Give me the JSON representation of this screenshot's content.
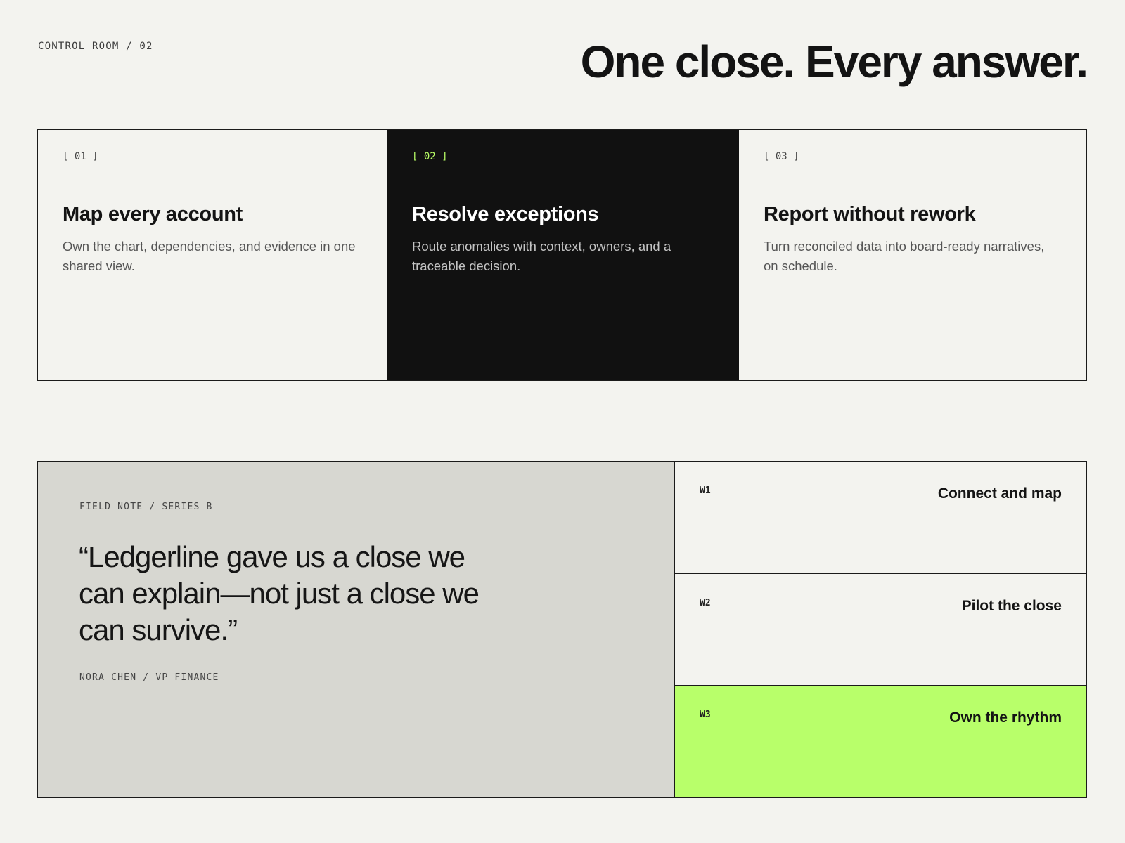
{
  "header": {
    "eyebrow": "CONTROL ROOM / 02",
    "headline": "One close. Every answer."
  },
  "features": [
    {
      "tag": "[ 01 ]",
      "title": "Map every account",
      "text": "Own the chart, dependencies, and evidence in one shared view."
    },
    {
      "tag": "[ 02 ]",
      "title": "Resolve exceptions",
      "text": "Route anomalies with context, owners, and a traceable decision."
    },
    {
      "tag": "[ 03 ]",
      "title": "Report without rework",
      "text": "Turn reconciled data into board-ready narratives, on schedule."
    }
  ],
  "testimonial": {
    "eyebrow": "FIELD NOTE / SERIES B",
    "quote": "“Ledgerline gave us a close we can explain—not just a close we can survive.”",
    "author": "NORA CHEN / VP FINANCE"
  },
  "timeline": [
    {
      "code": "W1",
      "title": "Connect and map"
    },
    {
      "code": "W2",
      "title": "Pilot the close"
    },
    {
      "code": "W3",
      "title": "Own the rhythm"
    }
  ],
  "colors": {
    "background": "#f3f3ef",
    "ink": "#111111",
    "accent": "#b8ff6a",
    "quote_panel": "#d7d7d1"
  }
}
